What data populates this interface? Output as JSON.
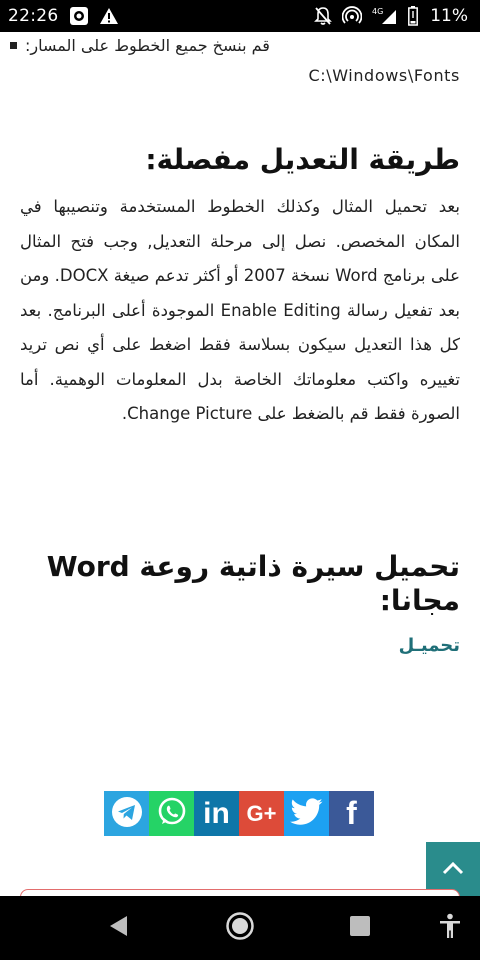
{
  "status_bar": {
    "time": "22:26",
    "battery": "11%",
    "network": "4G",
    "icons": [
      "screen-record-icon",
      "warning-icon",
      "mute-icon",
      "hotspot-icon",
      "signal-icon",
      "battery-icon"
    ]
  },
  "article": {
    "bullet_text": "قم بنسخ جميع الخطوط على المسار:",
    "font_path": "C:\\Windows\\Fonts",
    "section1_title": "طريقة التعديل مفصلة:",
    "section1_body": "بعد تحميل المثال وكذلك الخطوط المستخدمة وتنصيبها في المكان المخصص. نصل إلى مرحلة التعديل, وجب فتح المثال على برنامج Word نسخة 2007 أو أكثر تدعم صيغة DOCX. ومن بعد تفعيل رسالة Enable Editing الموجودة أعلى البرنامج. بعد كل هذا التعديل سيكون بسلاسة فقط اضغط على أي نص تريد تغييره واكتب معلوماتك الخاصة بدل المعلومات الوهمية. أما الصورة فقط قم بالضغط على Change Picture.",
    "section2_title": "تحميل سيرة ذاتية روعة Word مجانا:",
    "download_label": "تحميـل"
  },
  "share": {
    "buttons": [
      {
        "name": "telegram",
        "icon": "telegram-icon",
        "color": "#2ca5e0"
      },
      {
        "name": "whatsapp",
        "icon": "whatsapp-icon",
        "color": "#25d366"
      },
      {
        "name": "linkedin",
        "icon": "linkedin-icon",
        "label": "in",
        "color": "#0e76a8"
      },
      {
        "name": "google-plus",
        "icon": "google-plus-icon",
        "label": "G+",
        "color": "#dd4b39"
      },
      {
        "name": "twitter",
        "icon": "twitter-icon",
        "color": "#1da1f2"
      },
      {
        "name": "facebook",
        "icon": "facebook-icon",
        "label": "f",
        "color": "#3b5998"
      }
    ]
  },
  "colors": {
    "link": "#1f6f78",
    "scroll_top_bg": "#2a8c8c",
    "peek_border": "#e26d6d"
  },
  "nav_bar": {
    "icons": [
      "back-icon",
      "home-icon",
      "recents-icon",
      "accessibility-icon"
    ]
  }
}
